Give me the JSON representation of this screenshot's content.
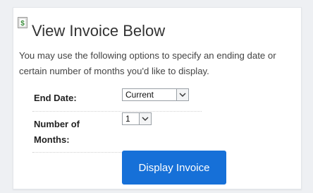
{
  "page": {
    "title": "View Invoice Below",
    "description": "You may use the following options to specify an ending date or certain number of months you'd like to display."
  },
  "form": {
    "end_date": {
      "label": "End Date:",
      "selected": "Current"
    },
    "months": {
      "label_line1": "Number of",
      "label_line2": "Months:",
      "selected": "1"
    }
  },
  "actions": {
    "display_label": "Display Invoice"
  },
  "colors": {
    "accent": "#1670d8",
    "icon_green": "#3c8d3c"
  }
}
